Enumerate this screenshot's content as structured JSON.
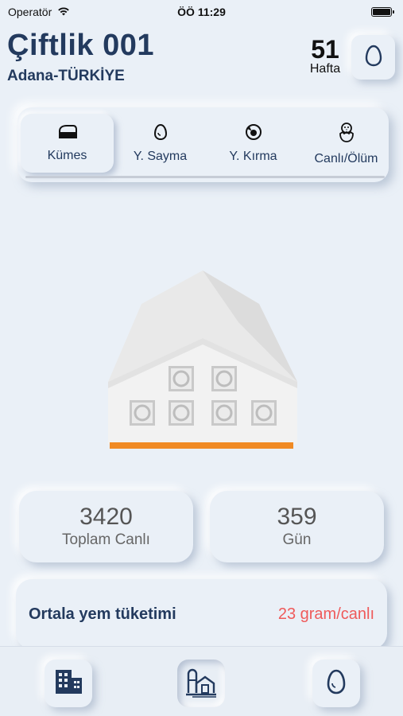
{
  "status_bar": {
    "carrier": "Operatör",
    "time": "ÖÖ 11:29",
    "wifi_icon": "wifi-icon",
    "battery_icon": "battery-icon"
  },
  "header": {
    "title": "Çiftlik 001",
    "location": "Adana-TÜRKİYE",
    "week_number": "51",
    "week_label": "Hafta",
    "egg_button_icon": "egg-icon"
  },
  "tabs": [
    {
      "label": "Kümes",
      "icon": "coop-icon",
      "active": true
    },
    {
      "label": "Y. Sayma",
      "icon": "egg-icon",
      "active": false
    },
    {
      "label": "Y. Kırma",
      "icon": "broken-egg-icon",
      "active": false
    },
    {
      "label": "Canlı/Ölüm",
      "icon": "chick-icon",
      "active": false
    }
  ],
  "stats": {
    "total_alive_value": "3420",
    "total_alive_label": "Toplam Canlı",
    "days_value": "359",
    "days_label": "Gün"
  },
  "feed": {
    "label": "Ortala yem tüketimi",
    "value": "23 gram/canlı"
  },
  "bottom_nav": [
    {
      "icon": "buildings-icon",
      "active": false
    },
    {
      "icon": "farm-icon",
      "active": true
    },
    {
      "icon": "egg-icon",
      "active": false
    }
  ],
  "colors": {
    "background": "#eaf0f7",
    "primary_text": "#233a5e",
    "accent_orange": "#f08a24",
    "feed_value": "#ef5a5a"
  }
}
